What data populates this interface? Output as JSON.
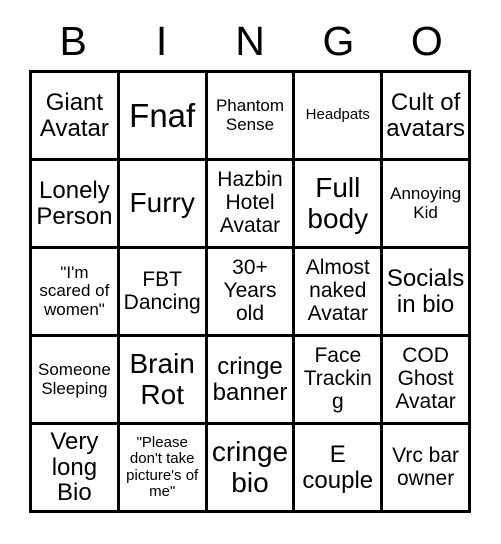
{
  "header": {
    "letters": [
      "B",
      "I",
      "N",
      "G",
      "O"
    ]
  },
  "grid": {
    "rows": 5,
    "columns": 5,
    "border_color": "#000000",
    "background_color": "#ffffff",
    "text_color": "#000000",
    "cells": [
      {
        "text": "Giant Avatar",
        "size": "lg"
      },
      {
        "text": "Fnaf",
        "size": "xxl"
      },
      {
        "text": "Phantom Sense",
        "size": "sm"
      },
      {
        "text": "Headpats",
        "size": "xs"
      },
      {
        "text": "Cult of avatars",
        "size": "lg"
      },
      {
        "text": "Lonely Person",
        "size": "lg"
      },
      {
        "text": "Furry",
        "size": "xl"
      },
      {
        "text": "Hazbin Hotel Avatar",
        "size": "md"
      },
      {
        "text": "Full body",
        "size": "xl"
      },
      {
        "text": "Annoying Kid",
        "size": "sm"
      },
      {
        "text": "\"I'm scared of women\"",
        "size": "sm"
      },
      {
        "text": "FBT Dancing",
        "size": "md"
      },
      {
        "text": "30+ Years old",
        "size": "md"
      },
      {
        "text": "Almost naked Avatar",
        "size": "md"
      },
      {
        "text": "Socials in bio",
        "size": "lg"
      },
      {
        "text": "Someone Sleeping",
        "size": "sm"
      },
      {
        "text": "Brain Rot",
        "size": "xl"
      },
      {
        "text": "cringe banner",
        "size": "lg"
      },
      {
        "text": "Face Tracking",
        "size": "md"
      },
      {
        "text": "COD Ghost Avatar",
        "size": "md"
      },
      {
        "text": "Very long Bio",
        "size": "lg"
      },
      {
        "text": "\"Please don't take picture's of me\"",
        "size": "xs"
      },
      {
        "text": "cringe bio",
        "size": "xl"
      },
      {
        "text": "E couple",
        "size": "lg"
      },
      {
        "text": "Vrc bar owner",
        "size": "md"
      }
    ]
  }
}
